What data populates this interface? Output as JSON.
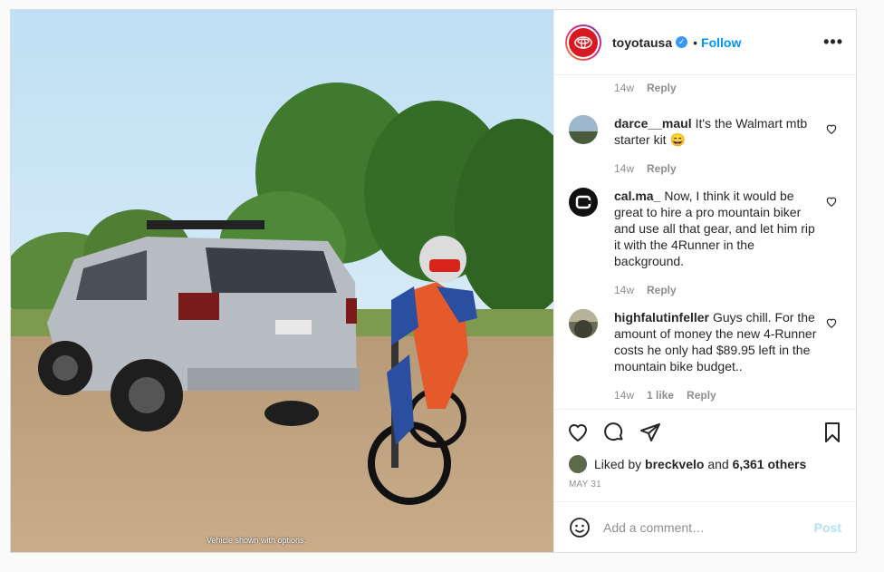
{
  "header": {
    "username": "toyotausa",
    "separator": "•",
    "follow_label": "Follow",
    "more_label": "•••"
  },
  "media": {
    "overlay_text": "Vehicle shown with options."
  },
  "comments": [
    {
      "meta_only": true,
      "time": "14w",
      "reply_label": "Reply"
    },
    {
      "user": "darce__maul",
      "text": "It's the Walmart mtb starter kit 😄",
      "time": "14w",
      "reply_label": "Reply",
      "avatar_color": "#6f8aa6"
    },
    {
      "user": "cal.ma_",
      "text": "Now, I think it would be great to hire a pro mountain biker and use all that gear, and let him rip it with the 4Runner in the background.",
      "time": "14w",
      "reply_label": "Reply",
      "avatar_color": "#111111"
    },
    {
      "user": "highfalutinfeller",
      "text": "Guys chill. For the amount of money the new 4-Runner costs he only had $89.95 left in the mountain bike budget..",
      "time": "14w",
      "likes": "1 like",
      "reply_label": "Reply",
      "avatar_color": "#6b6b55"
    }
  ],
  "likes": {
    "prefix": "Liked by",
    "user": "breckvelo",
    "middle": "and",
    "others": "6,361 others"
  },
  "date": "MAY 31",
  "add_comment": {
    "placeholder": "Add a comment…",
    "post_label": "Post"
  },
  "colors": {
    "accent": "#0095f6",
    "toyota_red": "#d71921"
  }
}
